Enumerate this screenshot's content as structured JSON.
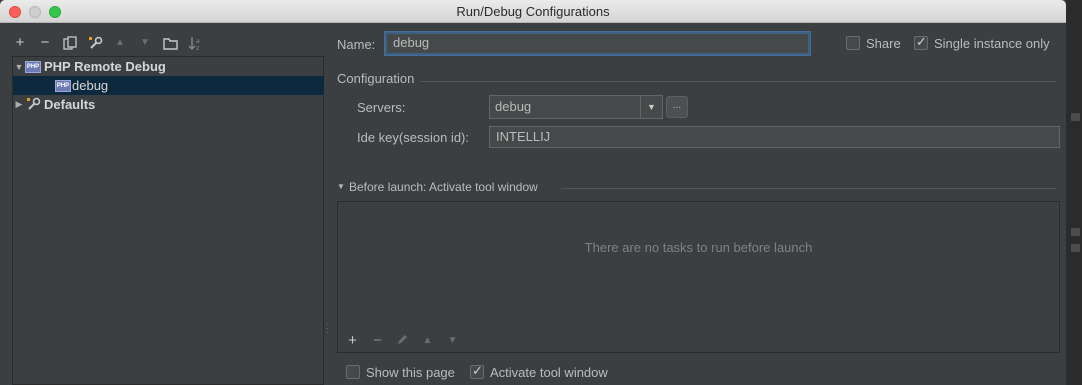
{
  "window": {
    "title": "Run/Debug Configurations"
  },
  "left": {
    "toolbar": [
      {
        "name": "add-icon",
        "glyph": "+"
      },
      {
        "name": "remove-icon",
        "glyph": "−"
      },
      {
        "name": "copy-icon",
        "glyph": "⎘"
      },
      {
        "name": "wrench-icon",
        "glyph": "✎"
      },
      {
        "name": "move-up-icon",
        "glyph": "▲"
      },
      {
        "name": "move-down-icon",
        "glyph": "▼"
      },
      {
        "name": "folder-icon",
        "glyph": "▭"
      },
      {
        "name": "sort-icon",
        "glyph": "↓"
      }
    ],
    "tree": [
      {
        "label": "PHP Remote Debug",
        "expanded": true,
        "level": 0
      },
      {
        "label": "debug",
        "selected": true,
        "level": 1
      },
      {
        "label": "Defaults",
        "expanded": false,
        "level": 0
      }
    ]
  },
  "form": {
    "name_label": "Name:",
    "name_value": "debug",
    "share_label": "Share",
    "single_instance_label": "Single instance only",
    "share_checked": false,
    "single_instance_checked": true,
    "configuration_label": "Configuration",
    "servers_label": "Servers:",
    "servers_value": "debug",
    "servers_more": "...",
    "idekey_label": "Ide key(session id):",
    "idekey_value": "INTELLIJ",
    "before_launch_label": "Before launch: Activate tool window",
    "no_tasks": "There are no tasks to run before launch",
    "show_page_label": "Show this page",
    "activate_label": "Activate tool window",
    "show_page_checked": false,
    "activate_checked": true
  }
}
